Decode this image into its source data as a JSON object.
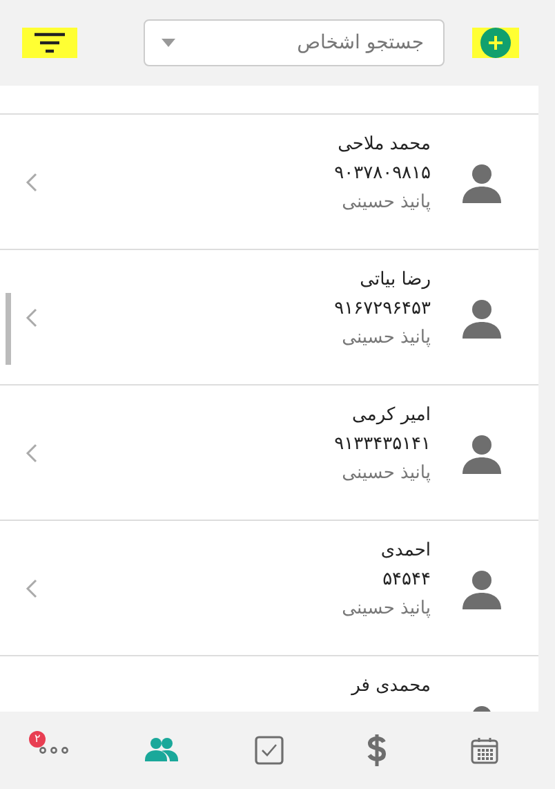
{
  "header": {
    "search": {
      "placeholder": "جستجو اشخاص"
    }
  },
  "contacts": [
    {
      "name": "محمد ملاحی",
      "phone": "۹۰۳۷۸۰۹۸۱۵",
      "owner": "پانیذ حسینی"
    },
    {
      "name": "رضا بیاتی",
      "phone": "۹۱۶۷۲۹۶۴۵۳",
      "owner": "پانیذ حسینی"
    },
    {
      "name": "امیر کرمی",
      "phone": "۹۱۳۳۴۳۵۱۴۱",
      "owner": "پانیذ حسینی"
    },
    {
      "name": "احمدی",
      "phone": "۵۴۵۴۴",
      "owner": "پانیذ حسینی"
    },
    {
      "name": "محمدی فر"
    }
  ],
  "nav": [
    {
      "kind": "calendar",
      "selected": false
    },
    {
      "kind": "dollar",
      "selected": false
    },
    {
      "kind": "tasks",
      "selected": false
    },
    {
      "kind": "people",
      "selected": true
    },
    {
      "kind": "more",
      "selected": false,
      "badge": "۲"
    }
  ]
}
